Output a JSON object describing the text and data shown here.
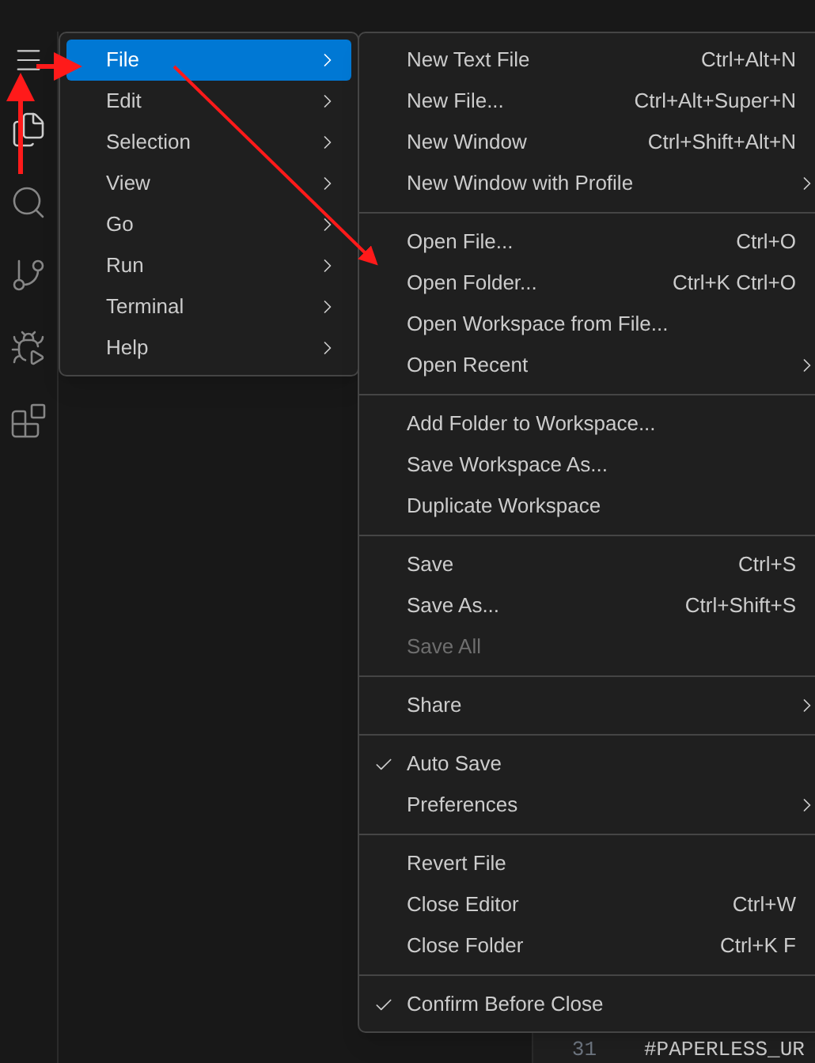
{
  "main_menu": {
    "items": [
      {
        "label": "File",
        "selected": true,
        "submenu": true
      },
      {
        "label": "Edit",
        "selected": false,
        "submenu": true
      },
      {
        "label": "Selection",
        "selected": false,
        "submenu": true
      },
      {
        "label": "View",
        "selected": false,
        "submenu": true
      },
      {
        "label": "Go",
        "selected": false,
        "submenu": true
      },
      {
        "label": "Run",
        "selected": false,
        "submenu": true
      },
      {
        "label": "Terminal",
        "selected": false,
        "submenu": true
      },
      {
        "label": "Help",
        "selected": false,
        "submenu": true
      }
    ]
  },
  "file_menu": {
    "groups": [
      {
        "items": [
          {
            "label": "New Text File",
            "shortcut": "Ctrl+Alt+N",
            "submenu": false,
            "checked": false,
            "disabled": false
          },
          {
            "label": "New File...",
            "shortcut": "Ctrl+Alt+Super+N",
            "submenu": false,
            "checked": false,
            "disabled": false
          },
          {
            "label": "New Window",
            "shortcut": "Ctrl+Shift+Alt+N",
            "submenu": false,
            "checked": false,
            "disabled": false
          },
          {
            "label": "New Window with Profile",
            "submenu": true,
            "checked": false,
            "disabled": false
          }
        ]
      },
      {
        "items": [
          {
            "label": "Open File...",
            "shortcut": "Ctrl+O",
            "submenu": false,
            "checked": false,
            "disabled": false
          },
          {
            "label": "Open Folder...",
            "shortcut": "Ctrl+K Ctrl+O",
            "submenu": false,
            "checked": false,
            "disabled": false
          },
          {
            "label": "Open Workspace from File...",
            "submenu": false,
            "checked": false,
            "disabled": false
          },
          {
            "label": "Open Recent",
            "submenu": true,
            "checked": false,
            "disabled": false
          }
        ]
      },
      {
        "items": [
          {
            "label": "Add Folder to Workspace...",
            "submenu": false,
            "checked": false,
            "disabled": false
          },
          {
            "label": "Save Workspace As...",
            "submenu": false,
            "checked": false,
            "disabled": false
          },
          {
            "label": "Duplicate Workspace",
            "submenu": false,
            "checked": false,
            "disabled": false
          }
        ]
      },
      {
        "items": [
          {
            "label": "Save",
            "shortcut": "Ctrl+S",
            "submenu": false,
            "checked": false,
            "disabled": false
          },
          {
            "label": "Save As...",
            "shortcut": "Ctrl+Shift+S",
            "submenu": false,
            "checked": false,
            "disabled": false
          },
          {
            "label": "Save All",
            "submenu": false,
            "checked": false,
            "disabled": true
          }
        ]
      },
      {
        "items": [
          {
            "label": "Share",
            "submenu": true,
            "checked": false,
            "disabled": false
          }
        ]
      },
      {
        "items": [
          {
            "label": "Auto Save",
            "submenu": false,
            "checked": true,
            "disabled": false
          },
          {
            "label": "Preferences",
            "submenu": true,
            "checked": false,
            "disabled": false
          }
        ]
      },
      {
        "items": [
          {
            "label": "Revert File",
            "submenu": false,
            "checked": false,
            "disabled": false
          },
          {
            "label": "Close Editor",
            "shortcut": "Ctrl+W",
            "submenu": false,
            "checked": false,
            "disabled": false
          },
          {
            "label": "Close Folder",
            "shortcut": "Ctrl+K F",
            "submenu": false,
            "checked": false,
            "disabled": false
          }
        ]
      },
      {
        "items": [
          {
            "label": "Confirm Before Close",
            "submenu": false,
            "checked": true,
            "disabled": false
          }
        ]
      }
    ]
  },
  "editor": {
    "lines": [
      {
        "number": "31",
        "text": "#PAPERLESS_UR"
      }
    ]
  }
}
